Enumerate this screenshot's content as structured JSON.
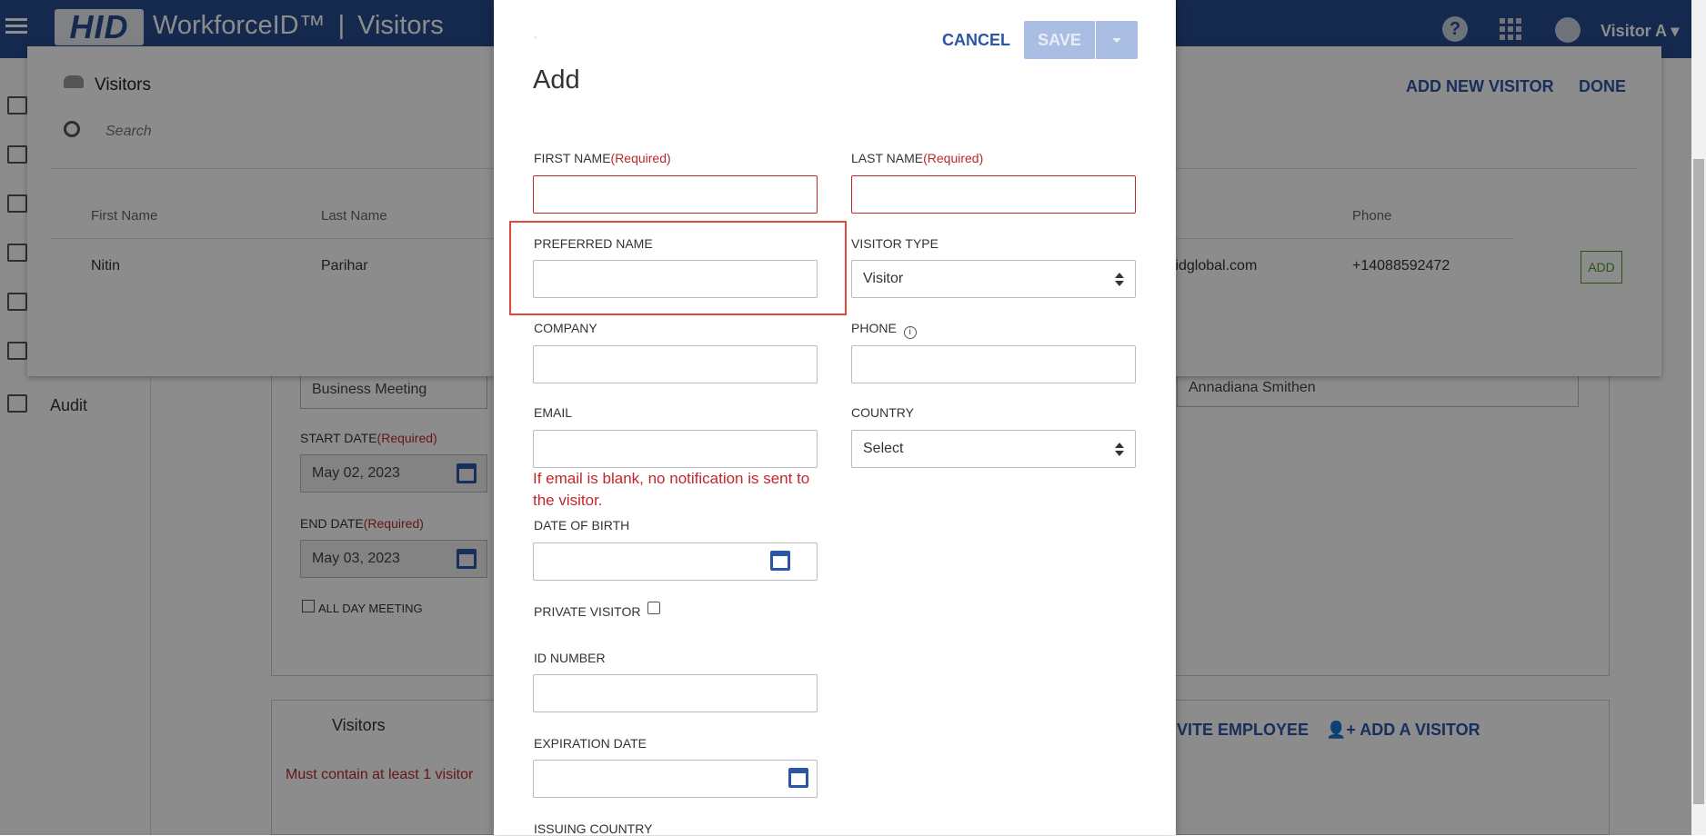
{
  "topbar": {
    "logo": "HID",
    "product": "WorkforceID™",
    "separator": "|",
    "section": "Visitors",
    "user": "Visitor A"
  },
  "sidenav": {
    "audit_label": "Audit"
  },
  "background_form": {
    "meeting_type_value": "Business Meeting",
    "host_value": "Annadiana Smithen",
    "start_date_label": "START DATE",
    "start_date_required": "(Required)",
    "start_date_value": "May 02, 2023",
    "end_date_label": "END DATE",
    "end_date_required": "(Required)",
    "end_date_value": "May 03, 2023",
    "all_day_label": "ALL DAY MEETING",
    "visitors_section_title": "Visitors",
    "visitors_error": "Must contain at least 1 visitor",
    "invite_employee_label": "VITE EMPLOYEE",
    "add_a_visitor_label": "ADD A VISITOR"
  },
  "visitors_panel": {
    "title": "Visitors",
    "search_placeholder": "Search",
    "add_new_visitor_label": "ADD NEW VISITOR",
    "done_label": "DONE",
    "columns": [
      "First Name",
      "Last Name",
      "Phone"
    ],
    "row": {
      "first_name": "Nitin",
      "last_name": "Parihar",
      "email_partial": "ihidglobal.com",
      "phone": "+14088592472",
      "add_label": "ADD"
    }
  },
  "modal": {
    "small_mark": "-",
    "title": "Add",
    "cancel_label": "CANCEL",
    "save_label": "SAVE",
    "first_name_label": "FIRST NAME",
    "first_name_required": "(Required)",
    "last_name_label": "LAST NAME",
    "last_name_required": "(Required)",
    "preferred_name_label": "PREFERRED NAME",
    "visitor_type_label": "VISITOR TYPE",
    "visitor_type_value": "Visitor",
    "company_label": "COMPANY",
    "phone_label": "PHONE",
    "email_label": "EMAIL",
    "email_note": "If email is blank, no notification is sent to the visitor.",
    "country_label": "COUNTRY",
    "country_value": "Select",
    "dob_label": "DATE OF BIRTH",
    "private_visitor_label": "PRIVATE VISITOR",
    "id_number_label": "ID NUMBER",
    "expiration_date_label": "EXPIRATION DATE",
    "issuing_country_label": "ISSUING COUNTRY"
  },
  "colors": {
    "brand_blue": "#274a8f",
    "link_blue": "#2d55a6",
    "required_red": "#b8282e",
    "highlight_red": "#e0483b",
    "add_green": "#4c9a2a"
  }
}
